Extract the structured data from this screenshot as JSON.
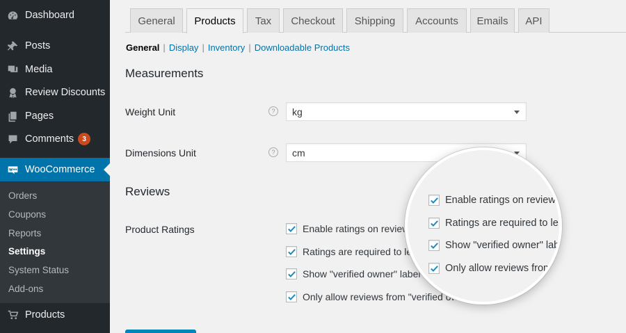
{
  "sidebar": {
    "items": [
      {
        "label": "Dashboard",
        "icon": "dashboard-icon"
      },
      {
        "label": "Posts",
        "icon": "pin-icon"
      },
      {
        "label": "Media",
        "icon": "media-icon"
      },
      {
        "label": "Review Discounts",
        "icon": "ribbon-icon"
      },
      {
        "label": "Pages",
        "icon": "pages-icon"
      },
      {
        "label": "Comments",
        "icon": "comment-icon",
        "badge": "3"
      },
      {
        "label": "WooCommerce",
        "icon": "woo-icon"
      },
      {
        "label": "Products",
        "icon": "cart-icon"
      }
    ],
    "submenu": [
      "Orders",
      "Coupons",
      "Reports",
      "Settings",
      "System Status",
      "Add-ons"
    ]
  },
  "tabs": [
    "General",
    "Products",
    "Tax",
    "Checkout",
    "Shipping",
    "Accounts",
    "Emails",
    "API"
  ],
  "subsections": [
    "General",
    "Display",
    "Inventory",
    "Downloadable Products"
  ],
  "measurements": {
    "title": "Measurements",
    "weight_label": "Weight Unit",
    "weight_value": "kg",
    "dimensions_label": "Dimensions Unit",
    "dimensions_value": "cm",
    "help": "?"
  },
  "reviews": {
    "title": "Reviews",
    "label": "Product Ratings",
    "options": [
      "Enable ratings on reviews",
      "Ratings are required to leave a review",
      "Show \"verified owner\" label for customer reviews",
      "Only allow reviews from \"verified owners\""
    ],
    "options_visible": [
      "Enable ratings on review",
      "Ratings are required to le",
      "Show \"verified owner\" label",
      "Only allow reviews from \"verified owne"
    ],
    "zoom_visible": [
      "Enable ratings on review.",
      "Ratings are required to le",
      "Show \"verified owner\" lab",
      "Only allow reviews from"
    ],
    "checked": [
      true,
      true,
      true,
      true
    ]
  },
  "colors": {
    "accent": "#0073aa",
    "sidebar": "#23282d",
    "badge": "#ca4a1f"
  }
}
